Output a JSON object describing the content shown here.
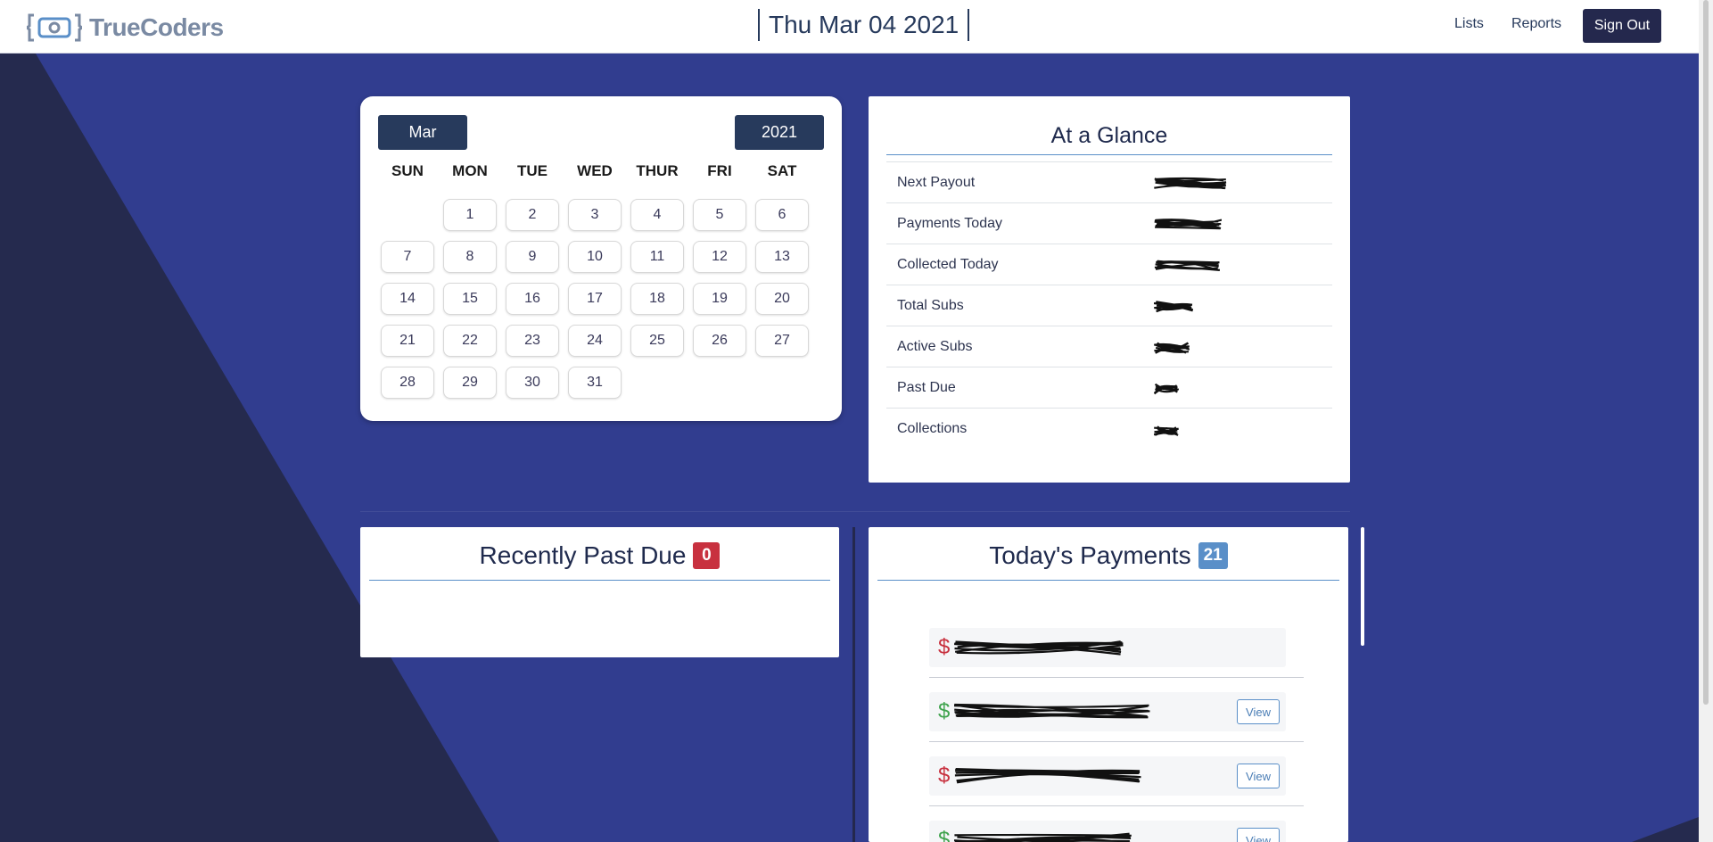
{
  "header": {
    "logo_text": "TrueCoders",
    "date": "Thu Mar 04 2021",
    "nav": {
      "lists": "Lists",
      "reports": "Reports"
    },
    "signout": "Sign Out"
  },
  "calendar": {
    "month": "Mar",
    "year": "2021",
    "weekdays": [
      "SUN",
      "MON",
      "TUE",
      "WED",
      "THUR",
      "FRI",
      "SAT"
    ],
    "first_weekday_index": 1,
    "days_in_month": 31
  },
  "glance": {
    "title": "At a Glance",
    "rows": [
      {
        "label": "Next Payout"
      },
      {
        "label": "Payments Today"
      },
      {
        "label": "Collected Today"
      },
      {
        "label": "Total Subs"
      },
      {
        "label": "Active Subs"
      },
      {
        "label": "Past Due"
      },
      {
        "label": "Collections"
      }
    ]
  },
  "past_due": {
    "title": "Recently Past Due",
    "count": "0"
  },
  "payments": {
    "title": "Today's Payments",
    "count": "21",
    "view_label": "View",
    "rows": [
      {
        "status": "red",
        "has_view": false
      },
      {
        "status": "green",
        "has_view": true
      },
      {
        "status": "red",
        "has_view": true
      },
      {
        "status": "green",
        "has_view": true
      }
    ]
  },
  "colors": {
    "navy": "#273a5c",
    "background_blue": "#313d8f",
    "dark_wedge": "#252a4e",
    "badge_red": "#c8313f",
    "badge_blue": "#5a8fc8",
    "dollar_red": "#c8313f",
    "dollar_green": "#3fa34d"
  },
  "icons": {
    "logo": "bracket-logo-icon",
    "dollar": "dollar-icon"
  }
}
